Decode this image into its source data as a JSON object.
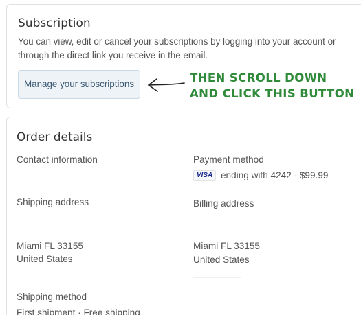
{
  "subscription": {
    "title": "Subscription",
    "description_line1": "You can view, edit or cancel your subscriptions by logging into your account or",
    "description_line2": "through the direct link you receive in the email.",
    "manage_button": "Manage your subscriptions"
  },
  "annotation": {
    "line1": "THEN SCROLL DOWN",
    "line2": "AND CLICK THIS BUTTON",
    "color": "#2f8a3a"
  },
  "order": {
    "title": "Order details",
    "contact_label": "Contact information",
    "payment_label": "Payment method",
    "card_brand": "VISA",
    "payment_detail": "ending with 4242 - $99.99",
    "shipping_label": "Shipping address",
    "billing_label": "Billing address",
    "shipping_city": "Miami FL 33155",
    "shipping_country": "United States",
    "billing_city": "Miami FL 33155",
    "billing_country": "United States",
    "shipping_method_label": "Shipping method",
    "shipping_method_value": "First shipment · Free shipping"
  },
  "icons": {
    "arrow": "left-arrow-icon",
    "card": "visa-card-icon"
  }
}
